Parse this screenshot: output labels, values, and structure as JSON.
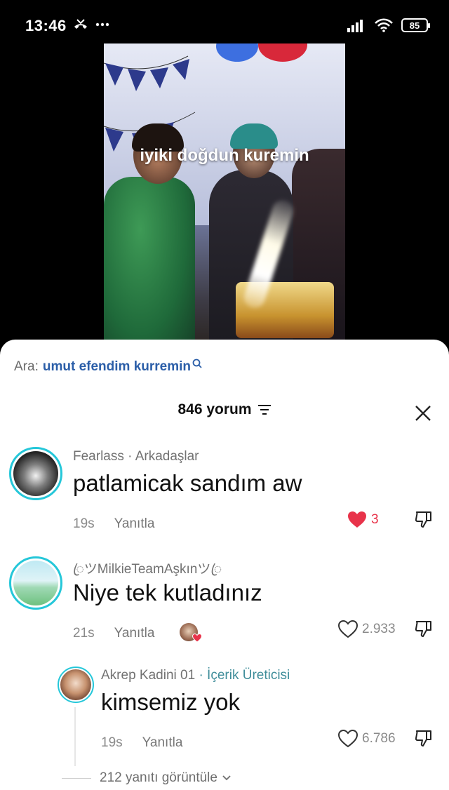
{
  "status": {
    "time": "13:46",
    "battery": "85"
  },
  "video": {
    "overlay_text": "iyiki doğdun kuremin"
  },
  "search": {
    "prefix": "Ara:",
    "term": "umut efendim kurremin"
  },
  "comments_header": {
    "count_label": "846 yorum"
  },
  "comments": [
    {
      "author": "Fearlass",
      "author_tag": "· Arkadaşlar",
      "text": "patlamicak sandım aw",
      "time": "19s",
      "reply_label": "Yanıtla",
      "likes": "3",
      "liked": true
    },
    {
      "author": "ꦿツMilkieTeamAşkınツꦿ",
      "author_tag": "",
      "text": "Niye tek kutladınız",
      "time": "21s",
      "reply_label": "Yanıtla",
      "likes": "2.933",
      "liked": false
    }
  ],
  "reply": {
    "author": "Akrep Kadini 01",
    "author_tag": "· İçerik Üreticisi",
    "text": "kimsemiz yok",
    "time": "19s",
    "reply_label": "Yanıtla",
    "likes": "6.786"
  },
  "view_replies_label": "212 yanıtı görüntüle",
  "colors": {
    "accent_blue": "#2b5ea8",
    "like_red": "#e8334a",
    "avatar_ring": "#25c7d9",
    "creator_tag": "#3f8d9a"
  }
}
